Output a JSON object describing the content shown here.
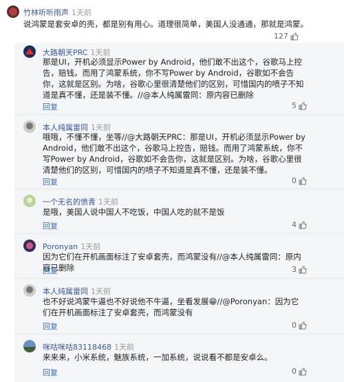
{
  "main_comment": {
    "user": "竹林听听雨声",
    "time": "1天前",
    "text": "说鸿蒙是套安卓的壳，都是别有用心。道理很简单，美国人没通通，那就是鸿蒙。",
    "likes": "127"
  },
  "replies": [
    {
      "user": "大路朝天PRC",
      "time": "1天前",
      "text": "那是UI，开机必须显示Power by Android，他们敢不出这个，谷歌马上控告，赔钱。而用了鸿蒙系统，你不写Power by Android，谷歌如不会告你，这就是区别。为啥，谷歌心里很清楚他们的区别，可惜国内的喷子不知道是真不懂，还是装不懂。//@本人纯属雷同：原内容已删除",
      "reply_label": "回复",
      "likes": "5"
    },
    {
      "user": "本人纯属雷同",
      "time": "1天前",
      "text": "哦哦，不懂不懂，坐等//@大路朝天PRC：那是UI，开机必须显示Power by Android，他们敢不出这个，谷歌马上控告，赔钱。而用了鸿蒙系统，你不写Power by Android，谷歌如不会告你，这就是区别。为啥，谷歌心里很清楚他们的区别，可惜国内的喷子不知道是真不懂，还是装不懂。",
      "reply_label": "回复",
      "likes": "0"
    },
    {
      "user": "一个无名的愤青",
      "time": "1天前",
      "text": "是哦，美国人说中国人不吃饭，中国人吃的就不是饭",
      "reply_label": "回复",
      "likes": "4"
    },
    {
      "user": "Poronyan",
      "time": "1天前",
      "text": "因为它们在开机画面标注了安卓套壳，而鸿蒙没有//@本人纯属雷同：原内容已删除",
      "reply_label": "回复",
      "likes": "3"
    },
    {
      "user": "本人纯属雷同",
      "time": "1天前",
      "text": "也不好说鸿蒙牛逼也不好说他不牛逼，坐看发展😁//@Poronyan：因为它们在开机画面标注了安卓套壳，而鸿蒙没有",
      "reply_label": "回复",
      "likes": "0"
    },
    {
      "user": "咪咕咪咕83118468",
      "time": "1天前",
      "text": "来来来，小米系统，魅族系统，一加系统，说说看不都是安卓么。",
      "reply_label": "回复",
      "likes": "0"
    }
  ],
  "colors": {
    "link": "#3b5998",
    "reply": "#3b6fb6",
    "meta": "#999999",
    "panel": "#f4f5f7"
  },
  "icons": {
    "like": "thumbs-up-icon"
  }
}
